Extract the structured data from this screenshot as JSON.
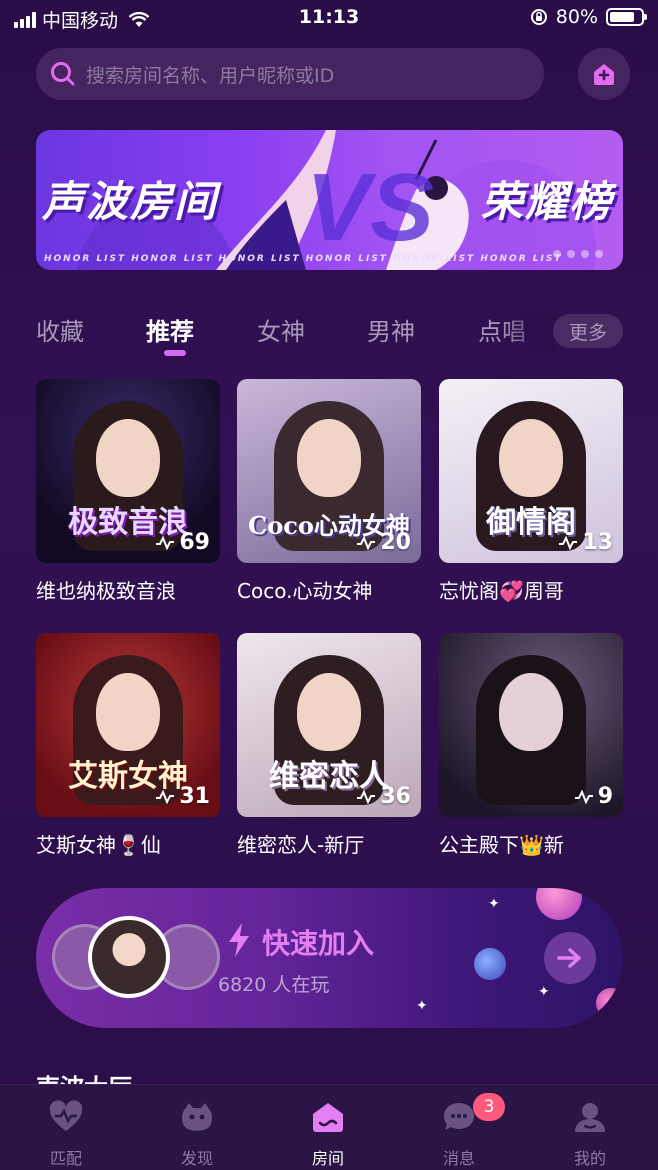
{
  "status_bar": {
    "carrier": "中国移动",
    "time": "11:13",
    "battery": "80%",
    "battery_level": 0.8
  },
  "search": {
    "placeholder": "搜索房间名称、用户昵称或ID"
  },
  "banner": {
    "left_text": "声波房间",
    "right_text": "荣耀榜",
    "strip_text": "HONOR  LIST HONOR  LIST HONOR  LIST HONOR  LIST HONOR  LIST HONOR  LIST"
  },
  "tabs": [
    {
      "label": "收藏"
    },
    {
      "label": "推荐"
    },
    {
      "label": "女神"
    },
    {
      "label": "男神"
    },
    {
      "label": "点唱"
    }
  ],
  "more_label": "更多",
  "rooms": [
    {
      "name": "维也纳极致音浪",
      "count": "69",
      "logo": "极致音浪",
      "bg": "#1a1030"
    },
    {
      "name": "Coco.心动女神",
      "count": "20",
      "logo": "Coco心动女神",
      "bg": "#9a88b0"
    },
    {
      "name": "忘忧阁💞周哥",
      "count": "13",
      "logo": "御情阁",
      "bg": "#e8e2ee"
    },
    {
      "name": "艾斯女神🍷仙",
      "count": "31",
      "logo": "艾斯女神",
      "bg": "#8a1a22"
    },
    {
      "name": "维密恋人-新厅",
      "count": "36",
      "logo": "维密恋人",
      "bg": "#d8cfd8"
    },
    {
      "name": "公主殿下👑新",
      "count": "9",
      "logo": "",
      "bg": "#3a2a44"
    }
  ],
  "quick_join": {
    "title": "快速加入",
    "subtitle": "6820 人在玩"
  },
  "section_peek": "声波大厅",
  "nav": [
    {
      "label": "匹配",
      "icon": "heart-pulse-icon"
    },
    {
      "label": "发现",
      "icon": "discover-icon"
    },
    {
      "label": "房间",
      "icon": "room-icon"
    },
    {
      "label": "消息",
      "icon": "message-icon",
      "badge": "3"
    },
    {
      "label": "我的",
      "icon": "profile-icon"
    }
  ]
}
